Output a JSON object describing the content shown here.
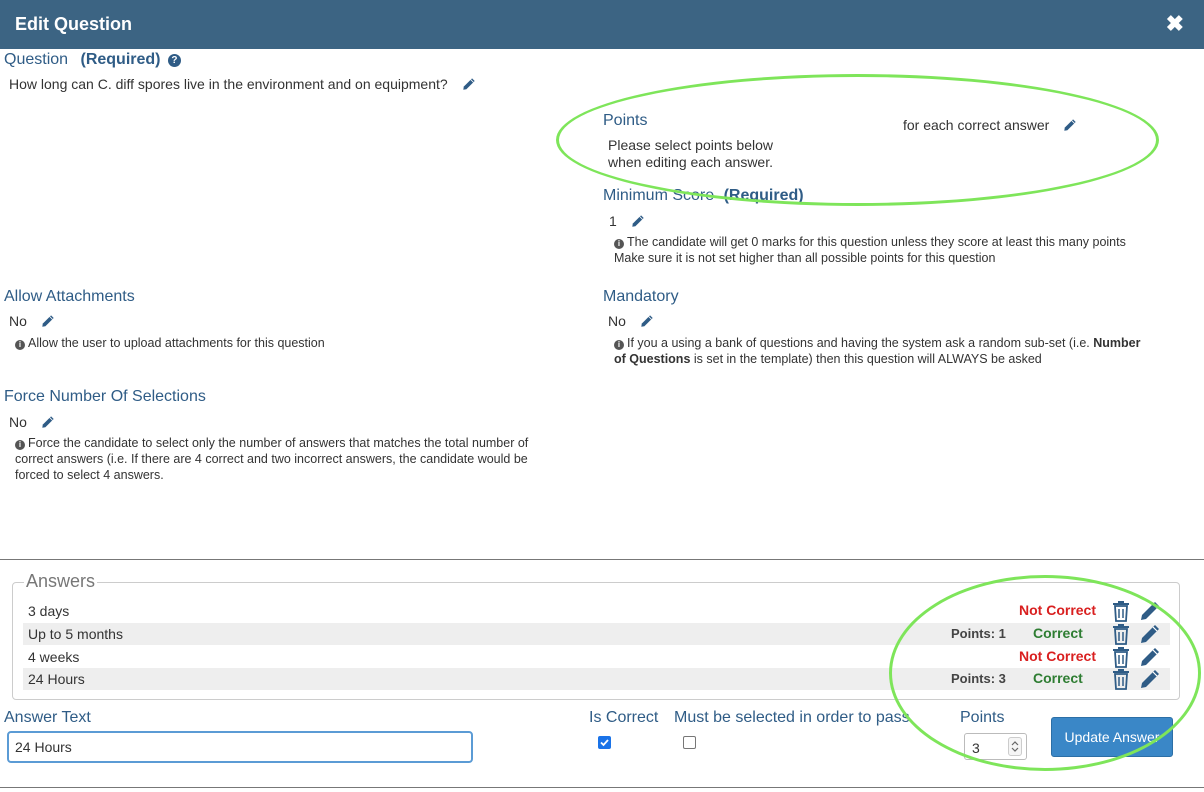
{
  "dialog": {
    "title": "Edit Question",
    "close_label": "✖"
  },
  "question": {
    "label": "Question",
    "required": "(Required)",
    "help_icon": "question-circle-icon",
    "value": "How long can C. diff spores live in the environment and on equipment?"
  },
  "points": {
    "label": "Points",
    "note_line1": "Please select points below",
    "note_line2": "when editing each answer.",
    "suffix": "for each correct answer"
  },
  "minimum_score": {
    "label": "Minimum Score",
    "required": "(Required)",
    "value": "1",
    "help_line1": "The candidate will get 0 marks for this question unless they score at least this many points",
    "help_line2": "Make sure it is not set higher than all possible points for this question"
  },
  "allow_attachments": {
    "label": "Allow Attachments",
    "value": "No",
    "help": "Allow the user to upload attachments for this question"
  },
  "mandatory": {
    "label": "Mandatory",
    "value": "No",
    "help_line1_a": "If you a using a bank of questions and having the system ask a random sub-set (i.e. ",
    "help_line1_b": "Number",
    "help_line2_a": "of Questions",
    "help_line2_b": " is set in the template) then this question will ALWAYS be asked"
  },
  "force_selections": {
    "label": "Force Number Of Selections",
    "value": "No",
    "help_line1": "Force the candidate to select only the number of answers that matches the total number of",
    "help_line2": "correct answers (i.e. If there are 4 correct and two incorrect answers, the candidate would be",
    "help_line3": "forced to select 4 answers."
  },
  "answers": {
    "legend": "Answers",
    "items": [
      {
        "text": "3 days",
        "points": "",
        "status": "Not Correct"
      },
      {
        "text": "Up to 5 months",
        "points": "Points: 1",
        "status": "Correct"
      },
      {
        "text": "4 weeks",
        "points": "",
        "status": "Not Correct"
      },
      {
        "text": "24 Hours",
        "points": "Points: 3",
        "status": "Correct"
      }
    ]
  },
  "editor": {
    "answer_text_label": "Answer Text",
    "answer_text_value": "24 Hours",
    "is_correct_label": "Is Correct",
    "is_correct_checked": true,
    "must_select_label": "Must be selected in order to pass",
    "must_select_checked": false,
    "points_label": "Points",
    "points_value": "3",
    "update_button": "Update Answer"
  },
  "colors": {
    "header": "#3c6483",
    "label_blue": "#2f5c86",
    "not_correct": "#d91f1f",
    "correct": "#2e7d32",
    "highlight_ellipse": "#7ee55a",
    "button": "#3a87c7"
  }
}
